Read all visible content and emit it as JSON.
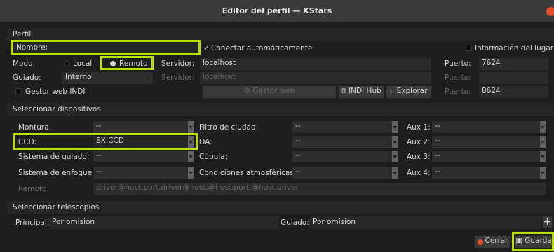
{
  "window": {
    "title": "Editor del perfil — KStars"
  },
  "profile": {
    "section_label": "Perfil",
    "name_label": "Nombre:",
    "name_value": "",
    "auto_connect_label": "Conectar automáticamente",
    "location_info_label": "Información del lugar",
    "mode_label": "Modo:",
    "mode_local": "Local",
    "mode_remote": "Remoto",
    "server_label": "Servidor:",
    "server_value": "localhost",
    "port_label": "Puerto:",
    "port_value": "7624",
    "guiding_label": "Guiado:",
    "guiding_value": "Interno",
    "guiding_server_label": "Servidor:",
    "guiding_server_placeholder": "localhost",
    "guiding_port_label": "Puerto:",
    "web_manager_label": "Gestor web INDI",
    "web_manager_button": "Gestor web",
    "indi_hub_button": "INDI Hub",
    "explore_button": "Explorar",
    "web_port_label": "Puerto:",
    "web_port_value": "8624"
  },
  "devices": {
    "section_label": "Seleccionar dispositivos",
    "mount_label": "Montura:",
    "mount_value": "--",
    "ccd_label": "CCD:",
    "ccd_value": "SX CCD",
    "guider_label": "Sistema de guiado:",
    "guider_value": "--",
    "focuser_label": "Sistema de enfoque:",
    "focuser_value": "--",
    "remote_label": "Remoto:",
    "remote_placeholder": "driver@host:port,driver@host,@host:port,@host,driver",
    "filter_label": "Filtro de ciudad:",
    "filter_value": "--",
    "oa_label": "OA:",
    "oa_value": "--",
    "dome_label": "Cúpula:",
    "dome_value": "--",
    "weather_label": "Condiciones atmosféricas:",
    "weather_value": "--",
    "aux1_label": "Aux 1:",
    "aux1_value": "--",
    "aux2_label": "Aux 2:",
    "aux2_value": "--",
    "aux3_label": "Aux 3:",
    "aux3_value": "--",
    "aux4_label": "Aux 4:",
    "aux4_value": "--"
  },
  "telescopes": {
    "section_label": "Seleccionar telescopios",
    "primary_label": "Principal:",
    "primary_value": "Por omisión",
    "guide_label": "Guiado:",
    "guide_value": "Por omisión",
    "add_label": "+"
  },
  "footer": {
    "close_label": "Cerrar",
    "save_label": "Guardar"
  },
  "icons": [
    "check-icon",
    "gear-icon",
    "link-icon",
    "magnify-icon",
    "close-icon",
    "save-icon"
  ],
  "colors": {
    "highlight": "#b6e000",
    "close_red": "#e0502a"
  }
}
